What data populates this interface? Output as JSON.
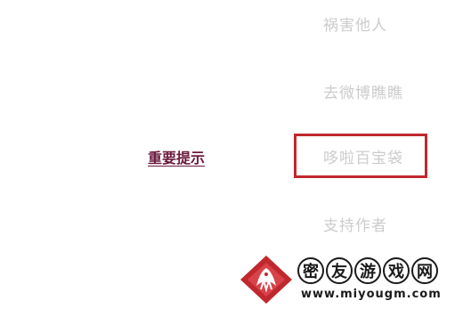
{
  "menu": {
    "options": [
      "祸害他人",
      "去微博瞧瞧",
      "哆啦百宝袋",
      "支持作者"
    ],
    "highlighted_index": 2
  },
  "notice": {
    "link_label": "重要提示"
  },
  "watermark": {
    "chars": [
      "密",
      "友",
      "游",
      "戏",
      "网"
    ],
    "url": "www.miyougm.com"
  },
  "colors": {
    "option_text": "#cccccc",
    "highlight_border": "#c0282e",
    "link_text": "#6b1a3c",
    "logo_red": "#c0282e"
  },
  "icons": {
    "watermark_logo": "red-diamond-bird-logo"
  }
}
